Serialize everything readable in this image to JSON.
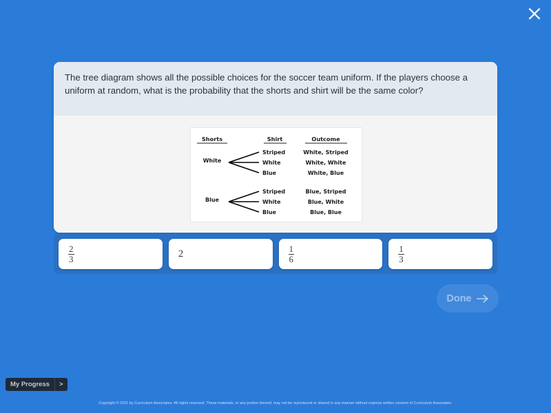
{
  "colors": {
    "background_blue": "#2b7bd9",
    "answer_panel_blue": "#2a71c4",
    "card_header": "#e2e9f1",
    "card_body": "#f4f4f4",
    "progress_dark": "#1d2a3a"
  },
  "close": {
    "icon": "close-icon",
    "label": "Close"
  },
  "question": {
    "prompt": "The tree diagram shows all the possible choices for the soccer team uniform. If the players choose a uniform at random, what is the probability that the shorts and shirt will be the same color?"
  },
  "tree_diagram": {
    "headers": [
      "Shorts",
      "Shirt",
      "Outcome"
    ],
    "groups": [
      {
        "shorts": "White",
        "branches": [
          {
            "shirt": "Striped",
            "outcome": "White, Striped"
          },
          {
            "shirt": "White",
            "outcome": "White, White"
          },
          {
            "shirt": "Blue",
            "outcome": "White, Blue"
          }
        ]
      },
      {
        "shorts": "Blue",
        "branches": [
          {
            "shirt": "Striped",
            "outcome": "Blue, Striped"
          },
          {
            "shirt": "White",
            "outcome": "Blue, White"
          },
          {
            "shirt": "Blue",
            "outcome": "Blue, Blue"
          }
        ]
      }
    ]
  },
  "answers": {
    "choices": [
      {
        "type": "fraction",
        "numerator": "2",
        "denominator": "3",
        "text": "2/3"
      },
      {
        "type": "whole",
        "value": "2",
        "text": "2"
      },
      {
        "type": "fraction",
        "numerator": "1",
        "denominator": "6",
        "text": "1/6"
      },
      {
        "type": "fraction",
        "numerator": "1",
        "denominator": "3",
        "text": "1/3"
      }
    ]
  },
  "done": {
    "label": "Done",
    "icon": "arrow-right-icon",
    "enabled": false
  },
  "progress": {
    "label": "My Progress",
    "chevron": ">"
  },
  "footer": {
    "copyright": "Copyright © 2021 by Curriculum Associates. All rights reserved. These materials, or any portion thereof, may not be reproduced or shared in any manner without express written consent of Curriculum Associates."
  }
}
